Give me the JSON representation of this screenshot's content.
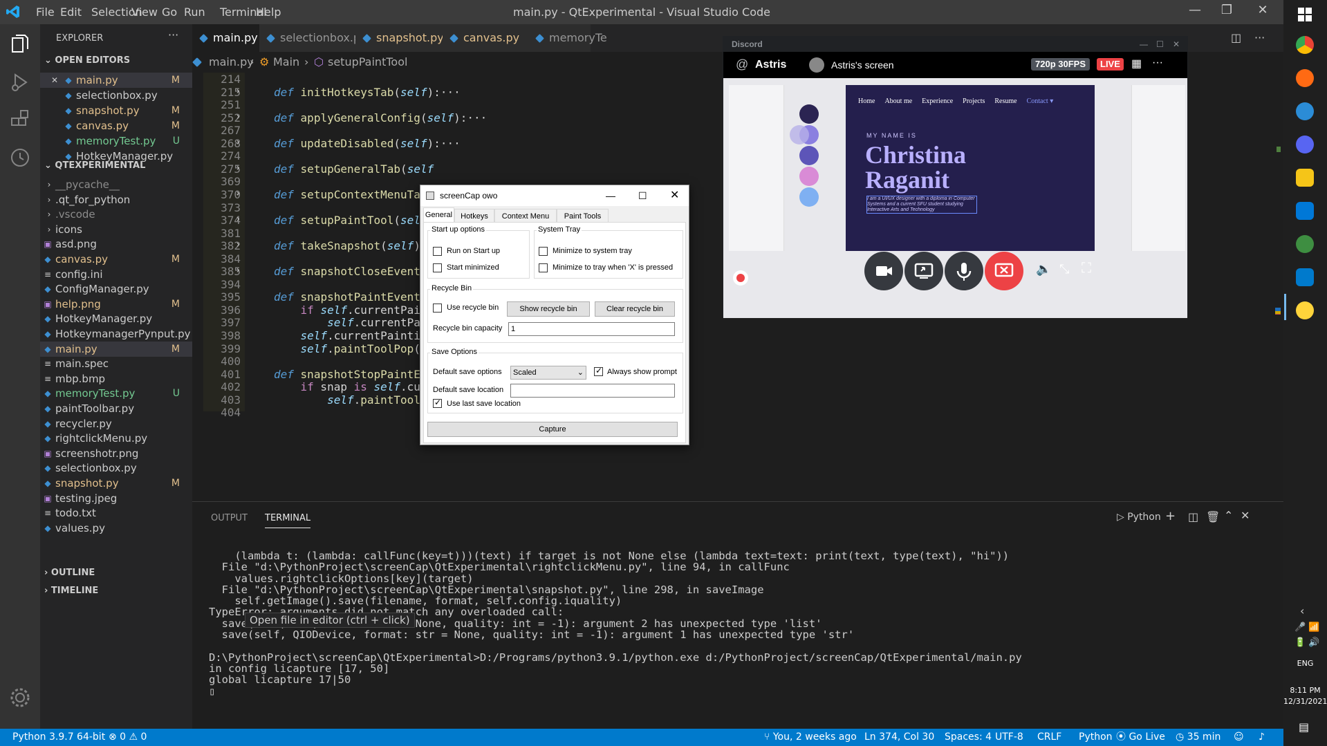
{
  "window": {
    "title": "main.py - QtExperimental - Visual Studio Code"
  },
  "menu": [
    "File",
    "Edit",
    "Selection",
    "View",
    "Go",
    "Run",
    "Terminal",
    "Help"
  ],
  "explorer": {
    "header": "EXPLORER",
    "open_editors_label": "OPEN EDITORS",
    "open_editors": [
      {
        "name": "main.py",
        "status": "M",
        "color": "#e2c08d"
      },
      {
        "name": "selectionbox.py",
        "status": "",
        "color": "#cccccc"
      },
      {
        "name": "snapshot.py",
        "status": "M",
        "color": "#e2c08d"
      },
      {
        "name": "canvas.py",
        "status": "M",
        "color": "#e2c08d"
      },
      {
        "name": "memoryTest.py",
        "status": "U",
        "color": "#73c991"
      },
      {
        "name": "HotkeyManager.py",
        "status": "",
        "color": "#cccccc"
      }
    ],
    "project_label": "QTEXPERIMENTAL",
    "files": [
      {
        "name": "__pycache__",
        "status": "",
        "type": "folder",
        "color": "#8c8c8c"
      },
      {
        "name": ".qt_for_python",
        "status": "",
        "type": "folder",
        "color": "#cccccc"
      },
      {
        "name": ".vscode",
        "status": "",
        "type": "folder",
        "color": "#8c8c8c"
      },
      {
        "name": "icons",
        "status": "",
        "type": "folder",
        "color": "#cccccc"
      },
      {
        "name": "asd.png",
        "status": "",
        "type": "img",
        "color": "#cccccc"
      },
      {
        "name": "canvas.py",
        "status": "M",
        "type": "py",
        "color": "#e2c08d"
      },
      {
        "name": "config.ini",
        "status": "",
        "type": "txt",
        "color": "#cccccc"
      },
      {
        "name": "ConfigManager.py",
        "status": "",
        "type": "py",
        "color": "#cccccc"
      },
      {
        "name": "help.png",
        "status": "M",
        "type": "img",
        "color": "#e2c08d"
      },
      {
        "name": "HotkeyManager.py",
        "status": "",
        "type": "py",
        "color": "#cccccc"
      },
      {
        "name": "HotkeymanagerPynput.py",
        "status": "",
        "type": "py",
        "color": "#cccccc"
      },
      {
        "name": "main.py",
        "status": "M",
        "type": "py",
        "color": "#e2c08d"
      },
      {
        "name": "main.spec",
        "status": "",
        "type": "txt",
        "color": "#cccccc"
      },
      {
        "name": "mbp.bmp",
        "status": "",
        "type": "txt",
        "color": "#cccccc"
      },
      {
        "name": "memoryTest.py",
        "status": "U",
        "type": "py",
        "color": "#73c991"
      },
      {
        "name": "paintToolbar.py",
        "status": "",
        "type": "py",
        "color": "#cccccc"
      },
      {
        "name": "recycler.py",
        "status": "",
        "type": "py",
        "color": "#cccccc"
      },
      {
        "name": "rightclickMenu.py",
        "status": "",
        "type": "py",
        "color": "#cccccc"
      },
      {
        "name": "screenshotr.png",
        "status": "",
        "type": "img",
        "color": "#cccccc"
      },
      {
        "name": "selectionbox.py",
        "status": "",
        "type": "py",
        "color": "#cccccc"
      },
      {
        "name": "snapshot.py",
        "status": "M",
        "type": "py",
        "color": "#e2c08d"
      },
      {
        "name": "testing.jpeg",
        "status": "",
        "type": "img",
        "color": "#cccccc"
      },
      {
        "name": "todo.txt",
        "status": "",
        "type": "txt",
        "color": "#cccccc"
      },
      {
        "name": "values.py",
        "status": "",
        "type": "py",
        "color": "#cccccc"
      }
    ],
    "outline_label": "OUTLINE",
    "timeline_label": "TIMELINE"
  },
  "tabs": [
    {
      "name": "main.py",
      "status": "M"
    },
    {
      "name": "selectionbox.py",
      "status": ""
    },
    {
      "name": "snapshot.py",
      "status": "M"
    },
    {
      "name": "canvas.py",
      "status": "M"
    },
    {
      "name": "memoryTe",
      "status": ""
    }
  ],
  "breadcrumb": {
    "file": "main.py",
    "cls": "Main",
    "method": "setupPaintTool"
  },
  "code": [
    {
      "ln": "214",
      "text": ""
    },
    {
      "ln": "215",
      "text": "def initHotkeysTab(self):···",
      "fold": true,
      "kind": "def"
    },
    {
      "ln": "251",
      "text": ""
    },
    {
      "ln": "252",
      "text": "def applyGeneralConfig(self):···",
      "fold": true,
      "kind": "def"
    },
    {
      "ln": "267",
      "text": ""
    },
    {
      "ln": "268",
      "text": "def updateDisabled(self):···",
      "fold": true,
      "kind": "def"
    },
    {
      "ln": "274",
      "text": ""
    },
    {
      "ln": "275",
      "text": "def setupGeneralTab(self",
      "fold": true,
      "kind": "def"
    },
    {
      "ln": "369",
      "text": ""
    },
    {
      "ln": "370",
      "text": "def setupContextMenuTab",
      "fold": true,
      "kind": "def"
    },
    {
      "ln": "373",
      "text": ""
    },
    {
      "ln": "374",
      "text": "def setupPaintTool(self",
      "fold": true,
      "kind": "def"
    },
    {
      "ln": "381",
      "text": ""
    },
    {
      "ln": "382",
      "text": "def takeSnapshot(self):",
      "fold": true,
      "kind": "def"
    },
    {
      "ln": "384",
      "text": ""
    },
    {
      "ln": "385",
      "text": "def snapshotCloseEvent(",
      "fold": true,
      "kind": "def"
    },
    {
      "ln": "394",
      "text": ""
    },
    {
      "ln": "395",
      "text": "def snapshotPaintEvent(",
      "kind": "def"
    },
    {
      "ln": "396",
      "text": "    if self.currentPain",
      "kind": "if"
    },
    {
      "ln": "397",
      "text": "        self.currentPai",
      "kind": "self"
    },
    {
      "ln": "398",
      "text": "    self.currentPaintin",
      "kind": "self"
    },
    {
      "ln": "399",
      "text": "    self.paintToolPop()",
      "kind": "self"
    },
    {
      "ln": "400",
      "text": ""
    },
    {
      "ln": "401",
      "text": "def snapshotStopPaintEv",
      "kind": "def"
    },
    {
      "ln": "402",
      "text": "    if snap is self.currentPainting:",
      "kind": "if"
    },
    {
      "ln": "403",
      "text": "        self.paintToolJoin()",
      "kind": "self"
    },
    {
      "ln": "404",
      "text": ""
    }
  ],
  "panel": {
    "tabs": [
      "OUTPUT",
      "TERMINAL"
    ],
    "python_label": "Python",
    "terminal_lines": [
      "    (lambda t: (lambda: callFunc(key=t)))(text) if target is not None else (lambda text=text: print(text, type(text), \"hi\"))",
      "  File \"d:\\PythonProject\\screenCap\\QtExperimental\\rightclickMenu.py\", line 94, in callFunc",
      "    values.rightclickOptions[key](target)",
      "  File \"d:\\PythonProject\\screenCap\\QtExperimental\\snapshot.py\", line 298, in saveImage",
      "    self.getImage().save(filename, format, self.config.iquality)",
      "TypeError: arguments did not match any overloaded call:",
      "  save(self, str, format: str = None, quality: int = -1): argument 2 has unexpected type 'list'",
      "  save(self, QIODevice, format: str = None, quality: int = -1): argument 1 has unexpected type 'str'",
      "",
      "D:\\PythonProject\\screenCap\\QtExperimental>D:/Programs/python3.9.1/python.exe d:/PythonProject/screenCap/QtExperimental/main.py",
      "in config licapture [17, 50]",
      "global licapture 17|50",
      "▯"
    ],
    "hover_tip": "Open file in editor (ctrl + click)"
  },
  "status": {
    "python": "Python 3.9.7 64-bit",
    "problems": "⊗ 0 ⚠ 0",
    "blame": "You, 2 weeks ago",
    "position": "Ln 374, Col 30",
    "spaces": "Spaces: 4",
    "encoding": "UTF-8",
    "eol": "CRLF",
    "lang": "Python",
    "golive": "Go Live",
    "timer": "35 min"
  },
  "dialog": {
    "title": "screenCap owo",
    "tabs": [
      "General",
      "Hotkeys",
      "Context Menu",
      "Paint Tools"
    ],
    "startup": {
      "label": "Start up options",
      "run": "Run on Start up",
      "minimized": "Start minimized"
    },
    "tray": {
      "label": "System Tray",
      "minimize": "Minimize to system tray",
      "minimize_x": "Minimize to tray when 'X' is pressed"
    },
    "recycle": {
      "label": "Recycle Bin",
      "use": "Use recycle bin",
      "show": "Show recycle bin",
      "clear": "Clear recycle bin",
      "capacity_label": "Recycle bin capacity",
      "capacity": "1"
    },
    "save": {
      "label": "Save Options",
      "default_label": "Default save options",
      "default_value": "Scaled",
      "always": "Always show prompt",
      "location_label": "Default save location",
      "location": "",
      "use_last": "Use last save location"
    },
    "capture": "Capture"
  },
  "discord": {
    "app": "Discord",
    "user": "Astris",
    "screen": "Astris's screen",
    "quality": "720p 30FPS",
    "live": "LIVE",
    "site": {
      "nav": [
        "Home",
        "About me",
        "Experience",
        "Projects",
        "Resume",
        "Contact ▾"
      ],
      "kicker": "MY NAME IS",
      "name1": "Christina",
      "name2": "Raganit",
      "blurb": "I am a UI/UX designer with a diploma in Computer Systems and a current SFU student studying Interactive Arts and Technology"
    }
  },
  "taskbar": {
    "time": "8:11 PM",
    "date": "12/31/2021",
    "lang": "ENG"
  }
}
